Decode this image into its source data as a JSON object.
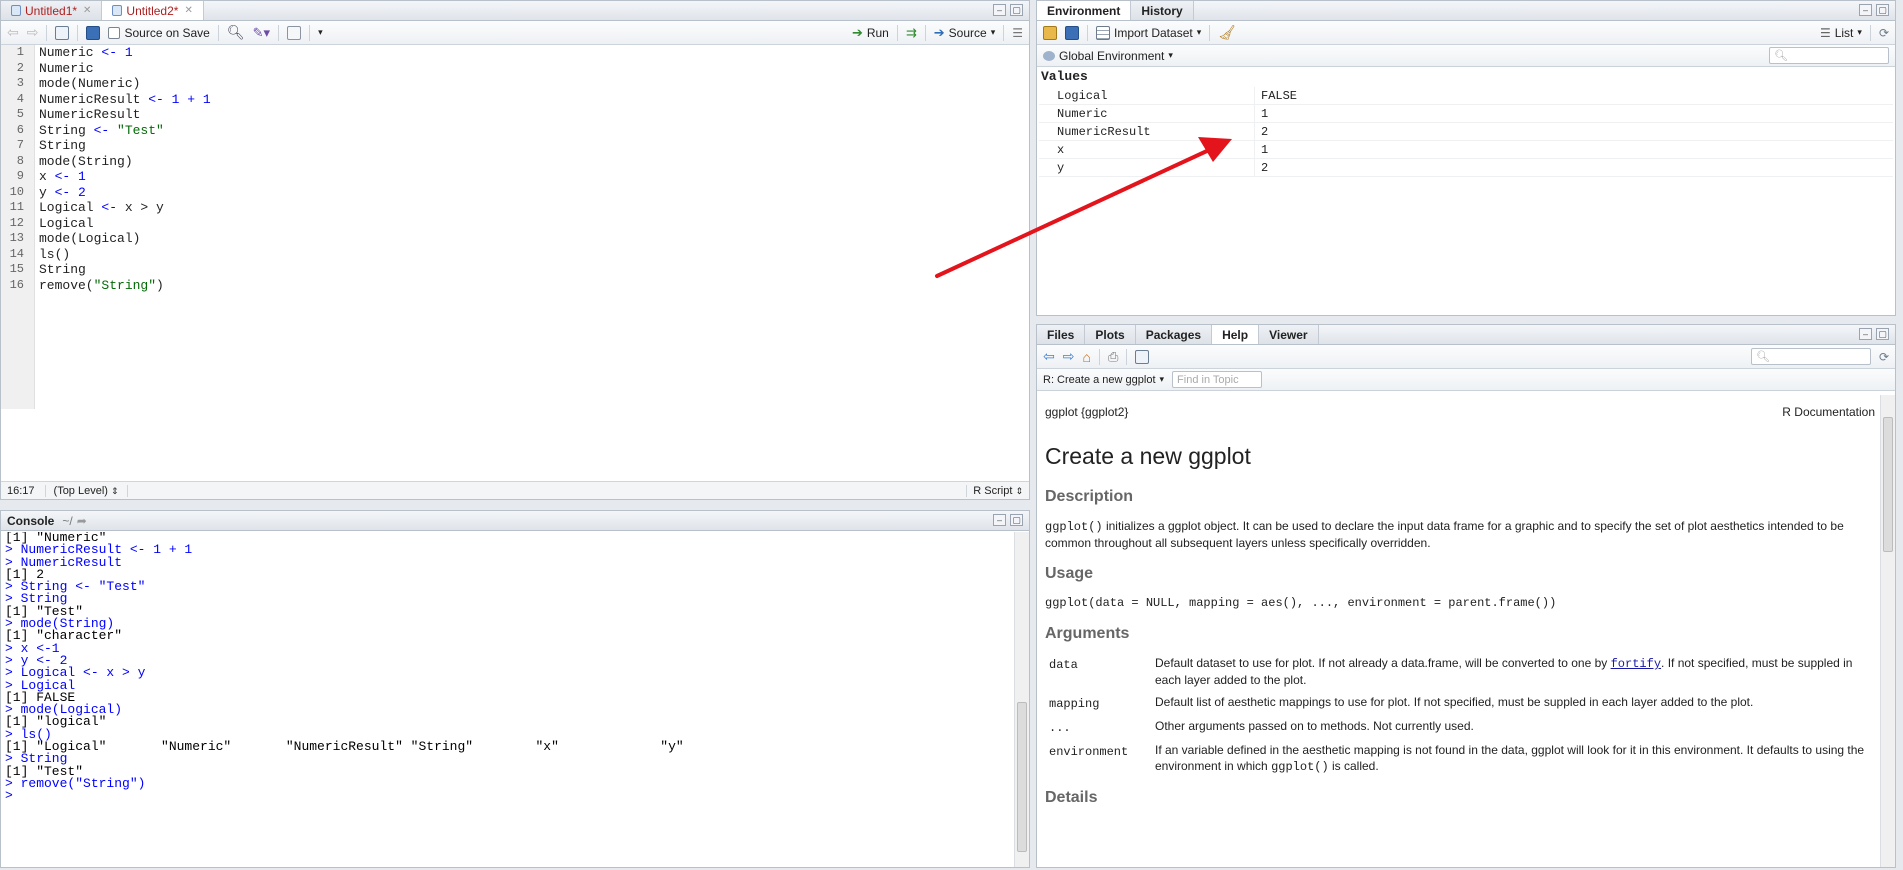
{
  "source": {
    "tabs": [
      {
        "label": "Untitled1*",
        "active": false
      },
      {
        "label": "Untitled2*",
        "active": true
      }
    ],
    "toolbar": {
      "source_on_save": "Source on Save",
      "run": "Run",
      "source": "Source"
    },
    "line_numbers": [
      "1",
      "2",
      "3",
      "4",
      "5",
      "6",
      "7",
      "8",
      "9",
      "10",
      "11",
      "12",
      "13",
      "14",
      "15",
      "16"
    ],
    "status": {
      "position": "16:17",
      "scope": "(Top Level)",
      "filetype": "R Script"
    }
  },
  "console": {
    "title": "Console",
    "path": "~/",
    "lines": [
      {
        "t": "[1] \"Numeric\"",
        "k": "out"
      },
      {
        "t": "> NumericResult <- 1 + 1",
        "k": "in"
      },
      {
        "t": "> NumericResult",
        "k": "in"
      },
      {
        "t": "[1] 2",
        "k": "out"
      },
      {
        "t": "> String <- \"Test\"",
        "k": "in"
      },
      {
        "t": "> String",
        "k": "in"
      },
      {
        "t": "[1] \"Test\"",
        "k": "out"
      },
      {
        "t": "> mode(String)",
        "k": "in"
      },
      {
        "t": "[1] \"character\"",
        "k": "out"
      },
      {
        "t": "> x <-1",
        "k": "in"
      },
      {
        "t": "> y <- 2",
        "k": "in"
      },
      {
        "t": "> Logical <- x > y",
        "k": "in"
      },
      {
        "t": "> Logical",
        "k": "in"
      },
      {
        "t": "[1] FALSE",
        "k": "out"
      },
      {
        "t": "> mode(Logical)",
        "k": "in"
      },
      {
        "t": "[1] \"logical\"",
        "k": "out"
      },
      {
        "t": "> ls()",
        "k": "in"
      },
      {
        "t": "[1] \"Logical\"       \"Numeric\"       \"NumericResult\" \"String\"        \"x\"             \"y\"",
        "k": "out"
      },
      {
        "t": "> String",
        "k": "in"
      },
      {
        "t": "[1] \"Test\"",
        "k": "out"
      },
      {
        "t": "> remove(\"String\")",
        "k": "in"
      },
      {
        "t": "> ",
        "k": "in"
      }
    ]
  },
  "environment": {
    "tabs": [
      {
        "label": "Environment",
        "active": true
      },
      {
        "label": "History",
        "active": false
      }
    ],
    "toolbar": {
      "import_dataset": "Import Dataset",
      "view_mode": "List"
    },
    "scope": "Global Environment",
    "section": "Values",
    "rows": [
      {
        "name": "Logical",
        "value": "FALSE"
      },
      {
        "name": "Numeric",
        "value": "1"
      },
      {
        "name": "NumericResult",
        "value": "2"
      },
      {
        "name": "x",
        "value": "1"
      },
      {
        "name": "y",
        "value": "2"
      }
    ]
  },
  "help": {
    "tabs": [
      {
        "label": "Files",
        "active": false
      },
      {
        "label": "Plots",
        "active": false
      },
      {
        "label": "Packages",
        "active": false
      },
      {
        "label": "Help",
        "active": true
      },
      {
        "label": "Viewer",
        "active": false
      }
    ],
    "topic": "R: Create a new ggplot",
    "find_placeholder": "Find in Topic",
    "doc": {
      "header_left": "ggplot {ggplot2}",
      "header_right": "R Documentation",
      "title": "Create a new ggplot",
      "description_heading": "Description",
      "description_code": "ggplot()",
      "description_text": " initializes a ggplot object. It can be used to declare the input data frame for a graphic and to specify the set of plot aesthetics intended to be common throughout all subsequent layers unless specifically overridden.",
      "usage_heading": "Usage",
      "usage_code": "ggplot(data = NULL, mapping = aes(), ..., environment = parent.frame())",
      "arguments_heading": "Arguments",
      "args": [
        {
          "name": "data",
          "pre": "Default dataset to use for plot. If not already a data.frame, will be converted to one by ",
          "link": "fortify",
          "post": ". If not specified, must be suppled in each layer added to the plot."
        },
        {
          "name": "mapping",
          "pre": "Default list of aesthetic mappings to use for plot. If not specified, must be suppled in each layer added to the plot.",
          "link": "",
          "post": ""
        },
        {
          "name": "...",
          "pre": "Other arguments passed on to methods. Not currently used.",
          "link": "",
          "post": ""
        },
        {
          "name": "environment",
          "pre": "If an variable defined in the aesthetic mapping is not found in the data, ggplot will look for it in this environment. It defaults to using the environment in which ",
          "link": "",
          "post": "",
          "code": "ggplot()",
          "tail": " is called."
        }
      ],
      "details_heading": "Details"
    }
  },
  "colors": {
    "keyword": "#0000ff",
    "string": "#036a07",
    "annotation_arrow": "#e3141b"
  }
}
